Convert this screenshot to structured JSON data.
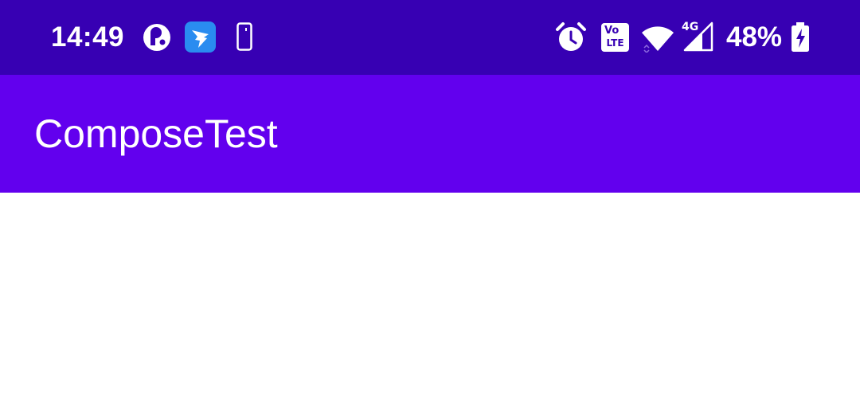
{
  "colors": {
    "status_bar": "#3700B3",
    "app_bar": "#6200EE",
    "on_primary": "#FFFFFF",
    "background": "#FFFFFF",
    "dingtalk_icon_bg": "#2A8CF0"
  },
  "status_bar": {
    "time": "14:49",
    "notification_icons": [
      "app-circle-icon",
      "dingtalk-icon",
      "phone-outline-icon"
    ],
    "system_icons": [
      "alarm-clock-icon",
      "volte-icon",
      "wifi-icon",
      "cellular-4g-icon",
      "battery-charging-icon"
    ],
    "volte_line1": "Vo",
    "volte_line2": "LTE",
    "network_type": "4G",
    "battery_percent": "48%",
    "battery_level": 0.48
  },
  "app_bar": {
    "title": "ComposeTest"
  }
}
